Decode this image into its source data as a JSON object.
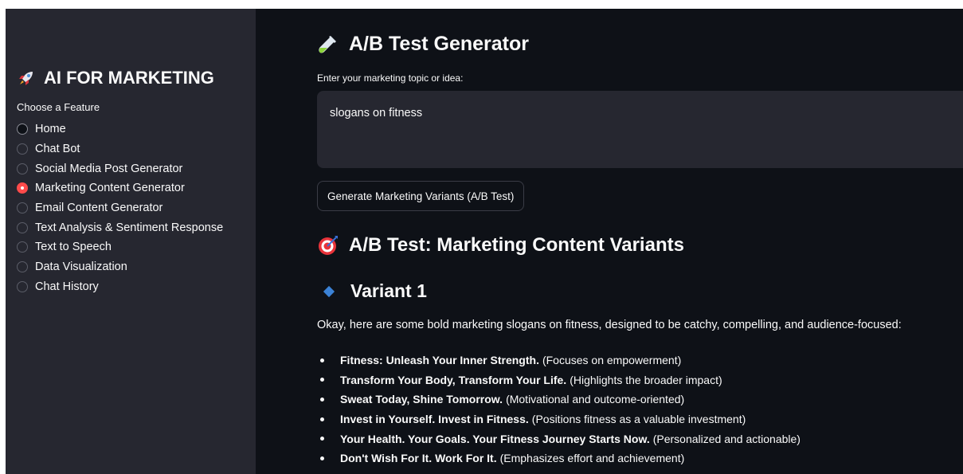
{
  "sidebar": {
    "brand": "AI FOR MARKETING",
    "choose_label": "Choose a Feature",
    "items": [
      {
        "label": "Home",
        "selected": false
      },
      {
        "label": "Chat Bot",
        "selected": false
      },
      {
        "label": "Social Media Post Generator",
        "selected": false
      },
      {
        "label": "Marketing Content Generator",
        "selected": true
      },
      {
        "label": "Email Content Generator",
        "selected": false
      },
      {
        "label": "Text Analysis & Sentiment Response",
        "selected": false
      },
      {
        "label": "Text to Speech",
        "selected": false
      },
      {
        "label": "Data Visualization",
        "selected": false
      },
      {
        "label": "Chat History",
        "selected": false
      }
    ]
  },
  "main": {
    "title": "A/B Test Generator",
    "input_label": "Enter your marketing topic or idea:",
    "input_value": "slogans on fitness",
    "button_label": "Generate Marketing Variants (A/B Test)",
    "section_title": "A/B Test: Marketing Content Variants",
    "variant_title": "Variant 1",
    "intro": "Okay, here are some bold marketing slogans on fitness, designed to be catchy, compelling, and audience-focused:",
    "slogans": [
      {
        "bold": "Fitness: Unleash Your Inner Strength.",
        "note": "(Focuses on empowerment)"
      },
      {
        "bold": "Transform Your Body, Transform Your Life.",
        "note": "(Highlights the broader impact)"
      },
      {
        "bold": "Sweat Today, Shine Tomorrow.",
        "note": "(Motivational and outcome-oriented)"
      },
      {
        "bold": "Invest in Yourself. Invest in Fitness.",
        "note": "(Positions fitness as a valuable investment)"
      },
      {
        "bold": "Your Health. Your Goals. Your Fitness Journey Starts Now.",
        "note": "(Personalized and actionable)"
      },
      {
        "bold": "Don't Wish For It. Work For It.",
        "note": "(Emphasizes effort and achievement)"
      }
    ]
  },
  "colors": {
    "sidebar_bg": "#262730",
    "main_bg": "#0e1117",
    "accent": "#ff4b4b",
    "text": "#fafafa",
    "diamond": "#3b82d6"
  },
  "icons": {
    "brand": "rocket-icon",
    "title": "test-tube-icon",
    "section": "target-icon",
    "variant": "diamond-icon"
  }
}
